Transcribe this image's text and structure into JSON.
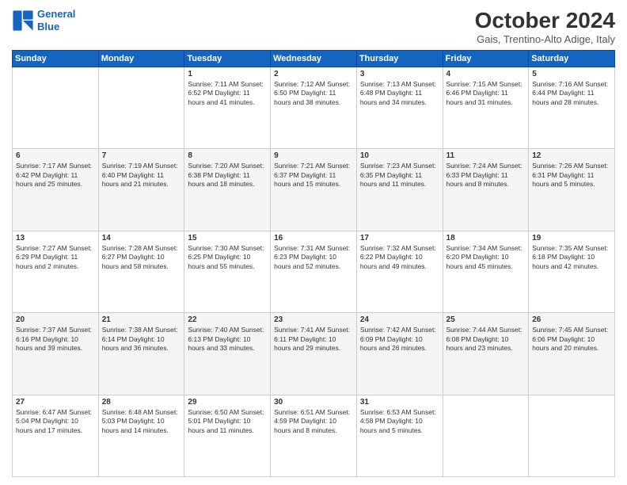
{
  "header": {
    "logo_line1": "General",
    "logo_line2": "Blue",
    "month": "October 2024",
    "location": "Gais, Trentino-Alto Adige, Italy"
  },
  "weekdays": [
    "Sunday",
    "Monday",
    "Tuesday",
    "Wednesday",
    "Thursday",
    "Friday",
    "Saturday"
  ],
  "weeks": [
    [
      {
        "day": "",
        "info": ""
      },
      {
        "day": "",
        "info": ""
      },
      {
        "day": "1",
        "info": "Sunrise: 7:11 AM\nSunset: 6:52 PM\nDaylight: 11 hours and 41 minutes."
      },
      {
        "day": "2",
        "info": "Sunrise: 7:12 AM\nSunset: 6:50 PM\nDaylight: 11 hours and 38 minutes."
      },
      {
        "day": "3",
        "info": "Sunrise: 7:13 AM\nSunset: 6:48 PM\nDaylight: 11 hours and 34 minutes."
      },
      {
        "day": "4",
        "info": "Sunrise: 7:15 AM\nSunset: 6:46 PM\nDaylight: 11 hours and 31 minutes."
      },
      {
        "day": "5",
        "info": "Sunrise: 7:16 AM\nSunset: 6:44 PM\nDaylight: 11 hours and 28 minutes."
      }
    ],
    [
      {
        "day": "6",
        "info": "Sunrise: 7:17 AM\nSunset: 6:42 PM\nDaylight: 11 hours and 25 minutes."
      },
      {
        "day": "7",
        "info": "Sunrise: 7:19 AM\nSunset: 6:40 PM\nDaylight: 11 hours and 21 minutes."
      },
      {
        "day": "8",
        "info": "Sunrise: 7:20 AM\nSunset: 6:38 PM\nDaylight: 11 hours and 18 minutes."
      },
      {
        "day": "9",
        "info": "Sunrise: 7:21 AM\nSunset: 6:37 PM\nDaylight: 11 hours and 15 minutes."
      },
      {
        "day": "10",
        "info": "Sunrise: 7:23 AM\nSunset: 6:35 PM\nDaylight: 11 hours and 11 minutes."
      },
      {
        "day": "11",
        "info": "Sunrise: 7:24 AM\nSunset: 6:33 PM\nDaylight: 11 hours and 8 minutes."
      },
      {
        "day": "12",
        "info": "Sunrise: 7:26 AM\nSunset: 6:31 PM\nDaylight: 11 hours and 5 minutes."
      }
    ],
    [
      {
        "day": "13",
        "info": "Sunrise: 7:27 AM\nSunset: 6:29 PM\nDaylight: 11 hours and 2 minutes."
      },
      {
        "day": "14",
        "info": "Sunrise: 7:28 AM\nSunset: 6:27 PM\nDaylight: 10 hours and 58 minutes."
      },
      {
        "day": "15",
        "info": "Sunrise: 7:30 AM\nSunset: 6:25 PM\nDaylight: 10 hours and 55 minutes."
      },
      {
        "day": "16",
        "info": "Sunrise: 7:31 AM\nSunset: 6:23 PM\nDaylight: 10 hours and 52 minutes."
      },
      {
        "day": "17",
        "info": "Sunrise: 7:32 AM\nSunset: 6:22 PM\nDaylight: 10 hours and 49 minutes."
      },
      {
        "day": "18",
        "info": "Sunrise: 7:34 AM\nSunset: 6:20 PM\nDaylight: 10 hours and 45 minutes."
      },
      {
        "day": "19",
        "info": "Sunrise: 7:35 AM\nSunset: 6:18 PM\nDaylight: 10 hours and 42 minutes."
      }
    ],
    [
      {
        "day": "20",
        "info": "Sunrise: 7:37 AM\nSunset: 6:16 PM\nDaylight: 10 hours and 39 minutes."
      },
      {
        "day": "21",
        "info": "Sunrise: 7:38 AM\nSunset: 6:14 PM\nDaylight: 10 hours and 36 minutes."
      },
      {
        "day": "22",
        "info": "Sunrise: 7:40 AM\nSunset: 6:13 PM\nDaylight: 10 hours and 33 minutes."
      },
      {
        "day": "23",
        "info": "Sunrise: 7:41 AM\nSunset: 6:11 PM\nDaylight: 10 hours and 29 minutes."
      },
      {
        "day": "24",
        "info": "Sunrise: 7:42 AM\nSunset: 6:09 PM\nDaylight: 10 hours and 26 minutes."
      },
      {
        "day": "25",
        "info": "Sunrise: 7:44 AM\nSunset: 6:08 PM\nDaylight: 10 hours and 23 minutes."
      },
      {
        "day": "26",
        "info": "Sunrise: 7:45 AM\nSunset: 6:06 PM\nDaylight: 10 hours and 20 minutes."
      }
    ],
    [
      {
        "day": "27",
        "info": "Sunrise: 6:47 AM\nSunset: 5:04 PM\nDaylight: 10 hours and 17 minutes."
      },
      {
        "day": "28",
        "info": "Sunrise: 6:48 AM\nSunset: 5:03 PM\nDaylight: 10 hours and 14 minutes."
      },
      {
        "day": "29",
        "info": "Sunrise: 6:50 AM\nSunset: 5:01 PM\nDaylight: 10 hours and 11 minutes."
      },
      {
        "day": "30",
        "info": "Sunrise: 6:51 AM\nSunset: 4:59 PM\nDaylight: 10 hours and 8 minutes."
      },
      {
        "day": "31",
        "info": "Sunrise: 6:53 AM\nSunset: 4:58 PM\nDaylight: 10 hours and 5 minutes."
      },
      {
        "day": "",
        "info": ""
      },
      {
        "day": "",
        "info": ""
      }
    ]
  ]
}
